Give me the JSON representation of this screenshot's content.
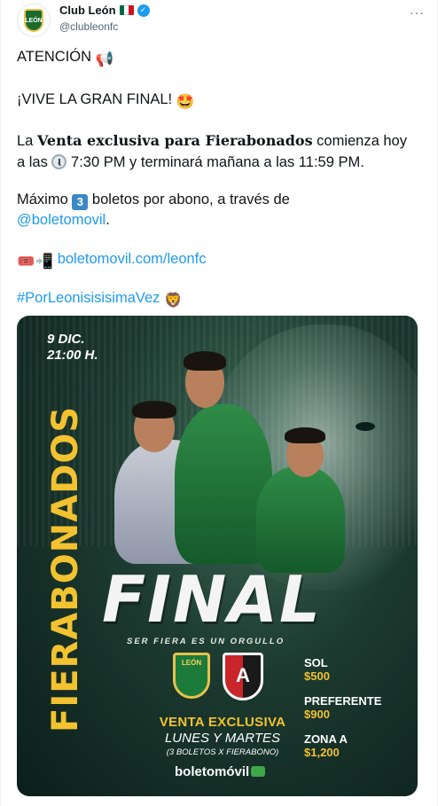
{
  "header": {
    "name": "Club León",
    "handle": "@clubleonfc",
    "more": "···",
    "avatar_text": "LEÓN",
    "flag_colors": [
      "#006847",
      "#ffffff",
      "#ce1126"
    ]
  },
  "tweet": {
    "line1_text": "ATENCIÓN",
    "line1_emoji": "📢",
    "line2_text": "¡VIVE LA GRAN FINAL!",
    "line2_emoji": "🤩",
    "line3_a": "La ",
    "line3_bold": "Venta exclusiva para Fierabonados",
    "line3_b": " comienza hoy",
    "line4_a": "a las ",
    "line4_b": " 7:30 PM y terminará mañana a las 11:59 PM.",
    "line5_a": "Máximo ",
    "line5_num": "3",
    "line5_b": " boletos por abono, a través de",
    "line6_mention": "@boletomovil",
    "line6_tail": ".",
    "line7_emoji": "🎟️📲",
    "line7_link": "boletomovil.com/leonfc",
    "line8_hashtag": "#PorLeonisisisimaVez",
    "line8_emoji": "🦁"
  },
  "poster": {
    "date_line1": "9 DIC.",
    "date_line2": "21:00 H.",
    "vertical_title": "FIERABONADOS",
    "final_title": "FINAL",
    "tagline": "SER FIERA ES UN ORGULLO",
    "crest_leon_text": "LEÓN",
    "crest_atlas_text": "A",
    "venta_line1": "VENTA EXCLUSIVA",
    "venta_line2": "LUNES Y MARTES",
    "venta_line3": "(3 BOLETOS X FIERABONO)",
    "brand": "boletomóvil",
    "prices": [
      {
        "label": "SOL",
        "value": "$500"
      },
      {
        "label": "PREFERENTE",
        "value": "$900"
      },
      {
        "label": "ZONA A",
        "value": "$1,200"
      }
    ],
    "accent_color": "#f2c230"
  }
}
